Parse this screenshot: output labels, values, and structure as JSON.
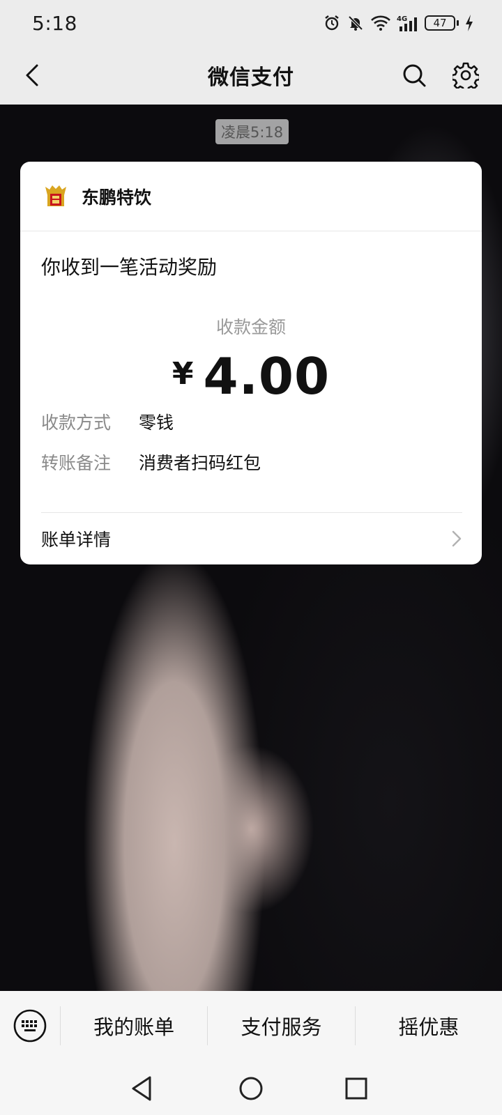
{
  "status_bar": {
    "time": "5:18",
    "battery": "47",
    "network": "4G"
  },
  "nav": {
    "title": "微信支付"
  },
  "chat": {
    "timestamp": "凌晨5:18"
  },
  "card": {
    "merchant_name": "东鹏特饮",
    "headline": "你收到一笔活动奖励",
    "amount_label": "收款金额",
    "currency_symbol": "¥",
    "amount": "4.00",
    "details": [
      {
        "label": "收款方式",
        "value": "零钱"
      },
      {
        "label": "转账备注",
        "value": "消费者扫码红包"
      }
    ],
    "bill_detail_label": "账单详情"
  },
  "bottom_menu": {
    "items": [
      "我的账单",
      "支付服务",
      "摇优惠"
    ]
  },
  "colors": {
    "background_bar": "#ececec",
    "card_bg": "#ffffff",
    "muted_text": "#999999",
    "logo_gold": "#d9a520",
    "logo_red": "#c8161d"
  }
}
